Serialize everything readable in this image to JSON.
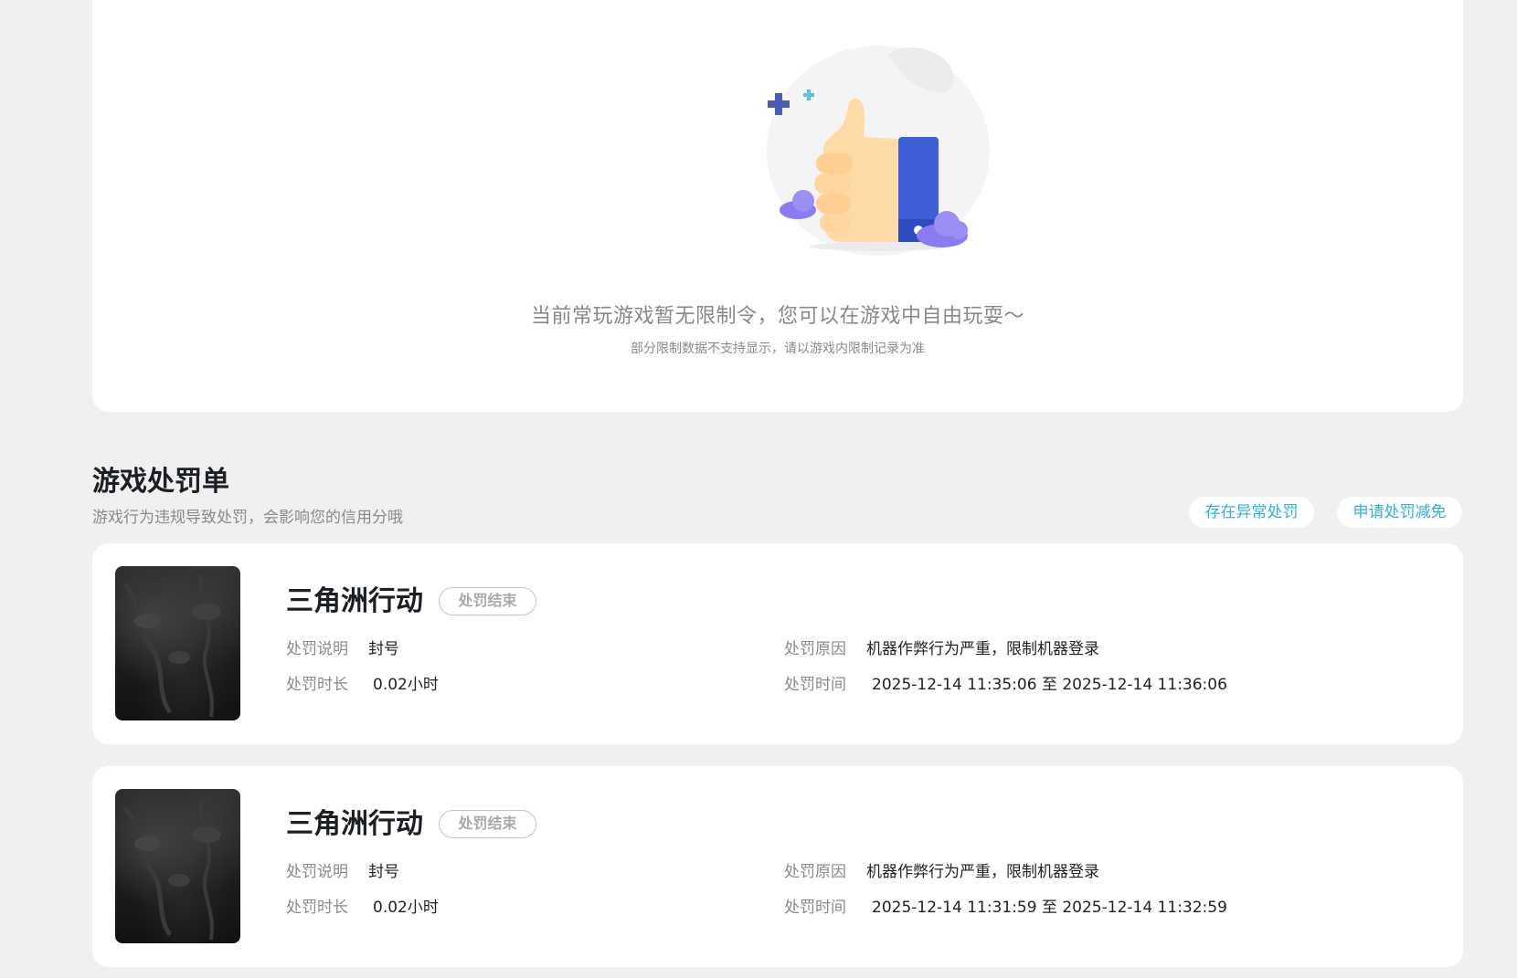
{
  "status": {
    "title": "当前常玩游戏暂无限制令，您可以在游戏中自由玩耍～",
    "subtitle": "部分限制数据不支持显示，请以游戏内限制记录为准"
  },
  "section": {
    "title": "游戏处罚单",
    "description": "游戏行为违规导致处罚，会影响您的信用分哦",
    "abnormal_button": "存在异常处罚",
    "appeal_button": "申请处罚减免"
  },
  "penalties": [
    {
      "game_name": "三角洲行动",
      "status_tag": "处罚结束",
      "desc_label": "处罚说明",
      "desc_value": "封号",
      "duration_label": "处罚时长",
      "duration_value": "0.02小时",
      "reason_label": "处罚原因",
      "reason_value": "机器作弊行为严重，限制机器登录",
      "time_label": "处罚时间",
      "time_value": "2025-12-14 11:35:06 至 2025-12-14 11:36:06"
    },
    {
      "game_name": "三角洲行动",
      "status_tag": "处罚结束",
      "desc_label": "处罚说明",
      "desc_value": "封号",
      "duration_label": "处罚时长",
      "duration_value": "0.02小时",
      "reason_label": "处罚原因",
      "reason_value": "机器作弊行为严重，限制机器登录",
      "time_label": "处罚时间",
      "time_value": "2025-12-14 11:31:59 至 2025-12-14 11:32:59"
    }
  ],
  "colors": {
    "background": "#f0f0f0",
    "card": "#ffffff",
    "accent": "#2db3d9",
    "thumb_blue": "#3f5fd6",
    "cloud_purple": "#8a7cf0",
    "sparkle_blue": "#4b5db3"
  },
  "icons": {
    "illustration": "thumbs-up-illustration",
    "thumbnail": "game-thumbnail"
  }
}
